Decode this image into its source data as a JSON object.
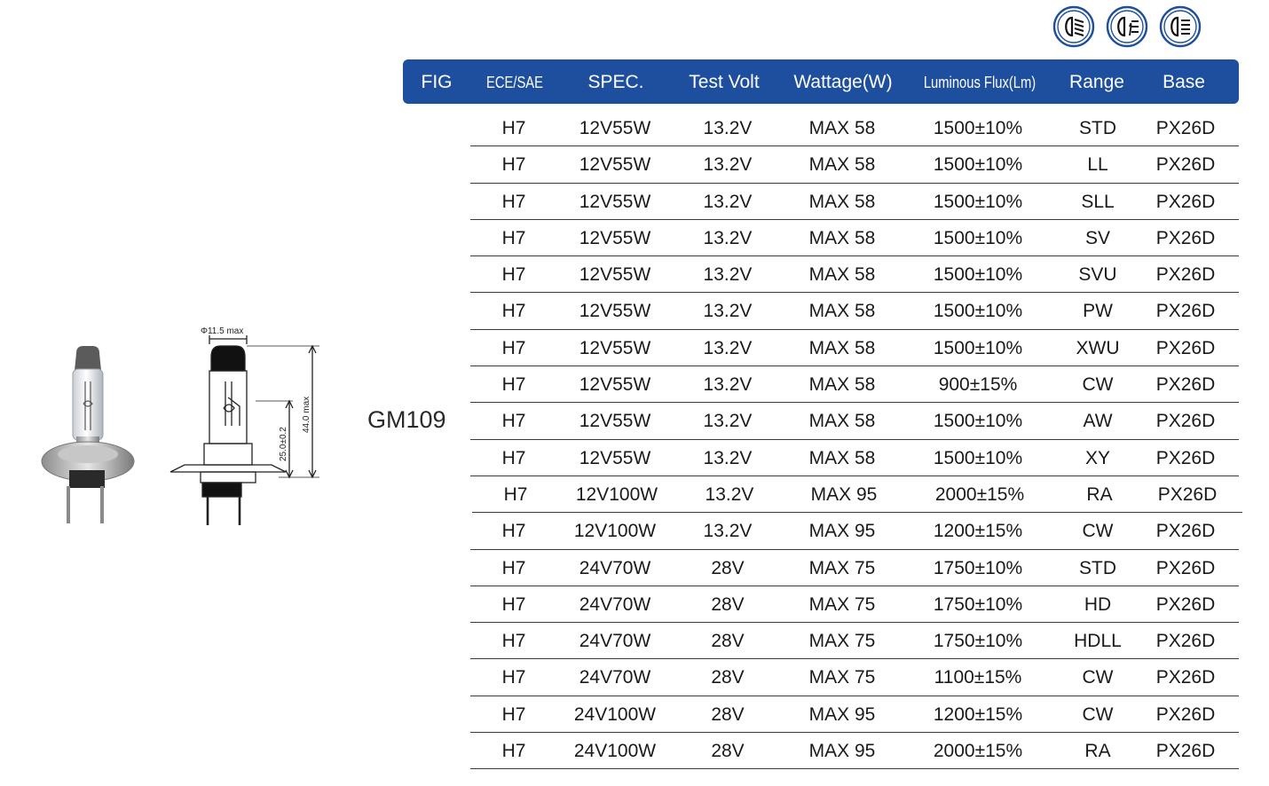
{
  "model": "GM109",
  "icons": [
    "low-beam-headlight-icon",
    "fog-light-icon",
    "high-beam-headlight-icon"
  ],
  "brand_color": "#1e4f9f",
  "figure": {
    "diameter_label": "Φ11.5 max",
    "length_label": "44.0 max",
    "focal_label": "25.0±0.2"
  },
  "header": [
    "FIG",
    "ECE/SAE",
    "SPEC.",
    "Test Volt",
    "Wattage(W)",
    "Luminous Flux(Lm)",
    "Range",
    "Base"
  ],
  "rows": [
    [
      "H7",
      "12V55W",
      "13.2V",
      "MAX 58",
      "1500±10%",
      "STD",
      "PX26D"
    ],
    [
      "H7",
      "12V55W",
      "13.2V",
      "MAX 58",
      "1500±10%",
      "LL",
      "PX26D"
    ],
    [
      "H7",
      "12V55W",
      "13.2V",
      "MAX 58",
      "1500±10%",
      "SLL",
      "PX26D"
    ],
    [
      "H7",
      "12V55W",
      "13.2V",
      "MAX 58",
      "1500±10%",
      "SV",
      "PX26D"
    ],
    [
      "H7",
      "12V55W",
      "13.2V",
      "MAX 58",
      "1500±10%",
      "SVU",
      "PX26D"
    ],
    [
      "H7",
      "12V55W",
      "13.2V",
      "MAX 58",
      "1500±10%",
      "PW",
      "PX26D"
    ],
    [
      "H7",
      "12V55W",
      "13.2V",
      "MAX 58",
      "1500±10%",
      "XWU",
      "PX26D"
    ],
    [
      "H7",
      "12V55W",
      "13.2V",
      "MAX 58",
      "900±15%",
      "CW",
      "PX26D"
    ],
    [
      "H7",
      "12V55W",
      "13.2V",
      "MAX 58",
      "1500±10%",
      "AW",
      "PX26D"
    ],
    [
      "H7",
      "12V55W",
      "13.2V",
      "MAX 58",
      "1500±10%",
      "XY",
      "PX26D"
    ],
    [
      "H7",
      "12V100W",
      "13.2V",
      "MAX 95",
      "2000±15%",
      "RA",
      "PX26D"
    ],
    [
      "H7",
      "12V100W",
      "13.2V",
      "MAX 95",
      "1200±15%",
      "CW",
      "PX26D"
    ],
    [
      "H7",
      "24V70W",
      "28V",
      "MAX 75",
      "1750±10%",
      "STD",
      "PX26D"
    ],
    [
      "H7",
      "24V70W",
      "28V",
      "MAX 75",
      "1750±10%",
      "HD",
      "PX26D"
    ],
    [
      "H7",
      "24V70W",
      "28V",
      "MAX 75",
      "1750±10%",
      "HDLL",
      "PX26D"
    ],
    [
      "H7",
      "24V70W",
      "28V",
      "MAX 75",
      "1100±15%",
      "CW",
      "PX26D"
    ],
    [
      "H7",
      "24V100W",
      "28V",
      "MAX 95",
      "1200±15%",
      "CW",
      "PX26D"
    ],
    [
      "H7",
      "24V100W",
      "28V",
      "MAX 95",
      "2000±15%",
      "RA",
      "PX26D"
    ]
  ]
}
